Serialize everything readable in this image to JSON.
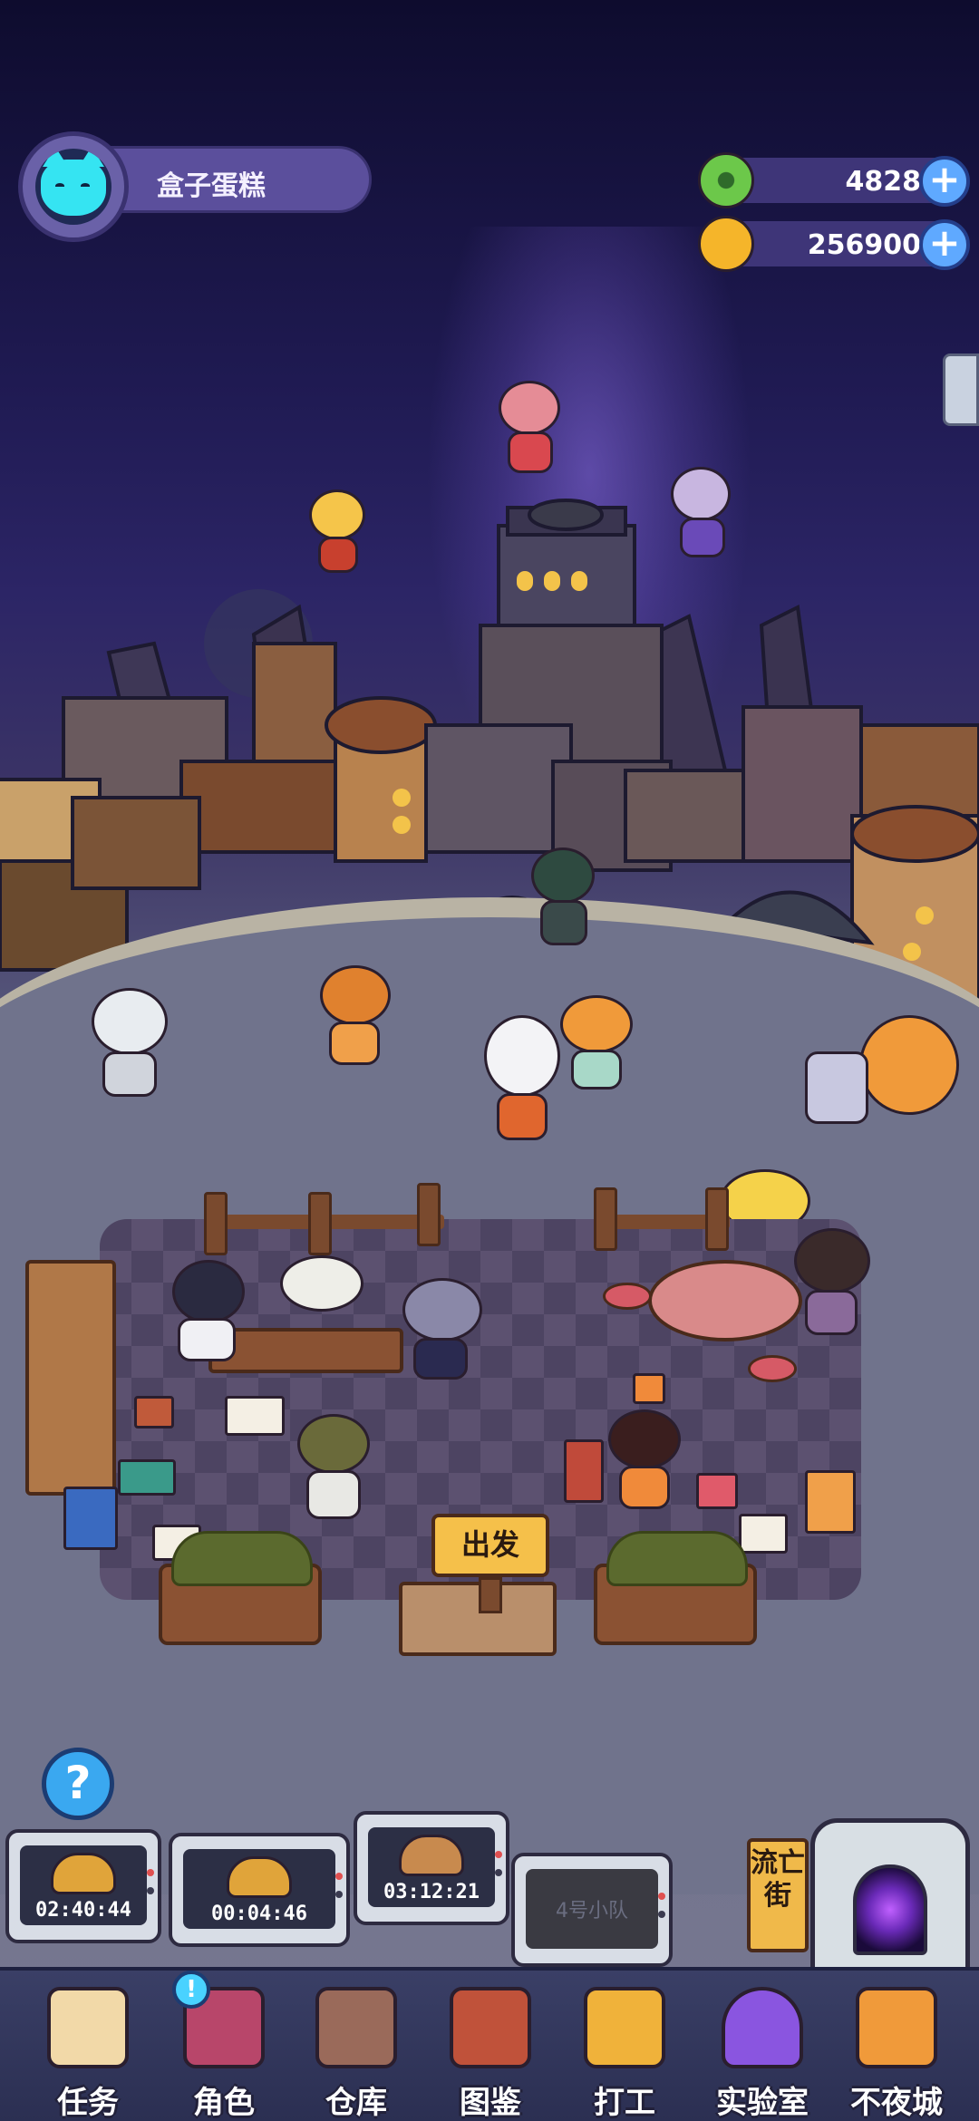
{
  "player": {
    "name": "盒子蛋糕",
    "avatar_icon": "cyan-cat-avatar-icon"
  },
  "currencies": [
    {
      "name": "green-donut-currency",
      "value": "4828",
      "icon": "green-donut-icon",
      "color": "#6cc84a"
    },
    {
      "name": "gold-planet-currency",
      "value": "256900",
      "icon": "gold-planet-icon",
      "color": "#f5b52a"
    }
  ],
  "scene": {
    "depart_label": "出发",
    "help_label": "?"
  },
  "teams": [
    {
      "timer": "02:40:44"
    },
    {
      "timer": "00:04:46"
    },
    {
      "timer": "03:12:21"
    },
    {
      "label": "4号小队"
    }
  ],
  "exile_street": {
    "label": "流亡街"
  },
  "bottom_nav": [
    {
      "label": "任务",
      "icon": "task-scroll-icon",
      "color": "#f2d9a8"
    },
    {
      "label": "角色",
      "icon": "character-card-icon",
      "color": "#b8466a",
      "badge": "!"
    },
    {
      "label": "仓库",
      "icon": "storage-chest-icon",
      "color": "#9a6a5a"
    },
    {
      "label": "图鉴",
      "icon": "codex-book-icon",
      "color": "#c0523a"
    },
    {
      "label": "打工",
      "icon": "work-computer-icon",
      "color": "#f0b23a"
    },
    {
      "label": "实验室",
      "icon": "lab-flask-icon",
      "color": "#8a55e0"
    },
    {
      "label": "不夜城",
      "icon": "orange-cat-city-icon",
      "color": "#f09a3a"
    }
  ]
}
